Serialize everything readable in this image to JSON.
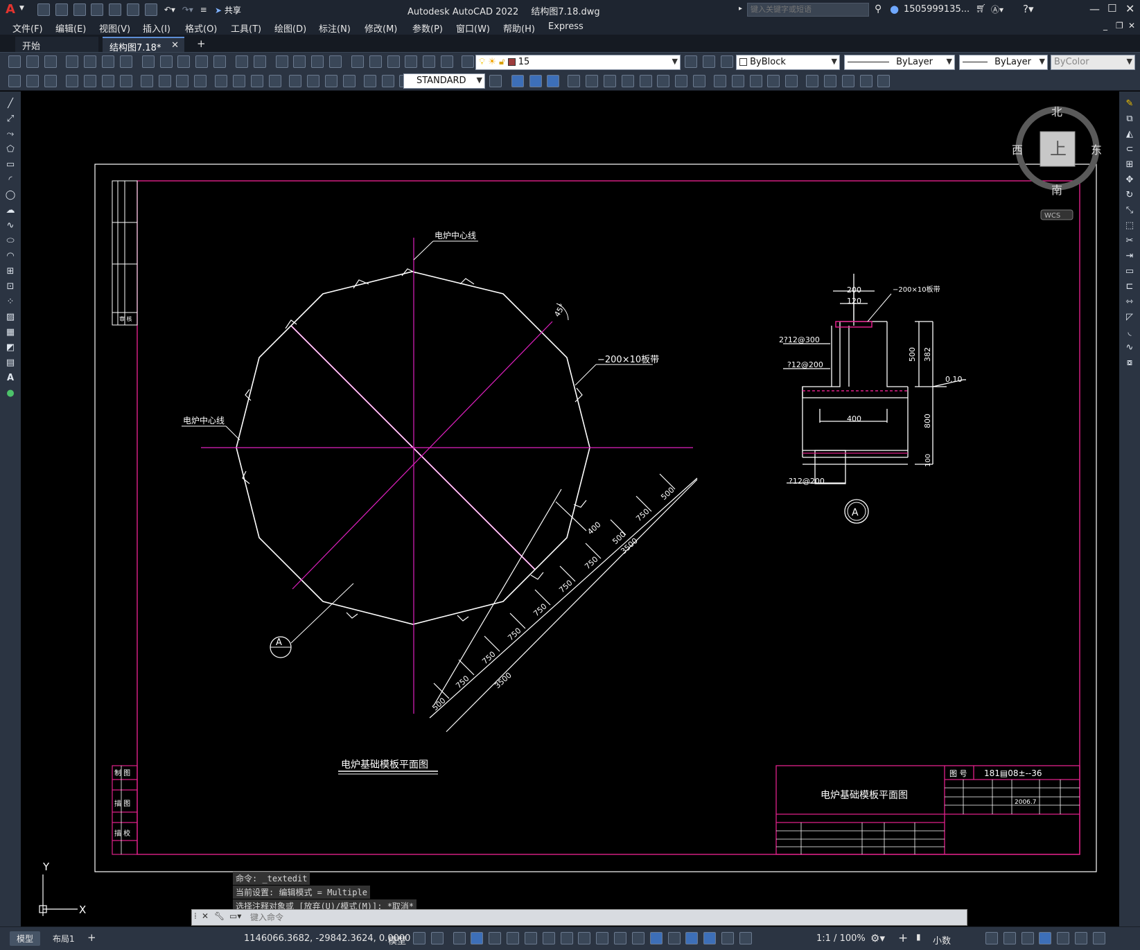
{
  "window": {
    "app_logo": "A",
    "title": "Autodesk AutoCAD 2022",
    "file": "结构图7.18.dwg",
    "share": "共享",
    "search_placeholder": "键入关键字或短语",
    "user": "1505999135...",
    "accent": "#c8102e"
  },
  "menu": [
    "文件(F)",
    "编辑(E)",
    "视图(V)",
    "插入(I)",
    "格式(O)",
    "工具(T)",
    "绘图(D)",
    "标注(N)",
    "修改(M)",
    "参数(P)",
    "窗口(W)",
    "帮助(H)",
    "Express"
  ],
  "tabs": [
    {
      "label": "开始",
      "active": false
    },
    {
      "label": "结构图7.18*",
      "active": true
    }
  ],
  "toolbar": {
    "layer": "15",
    "color": "ByBlock",
    "linetype": "ByLayer",
    "lineweight": "ByLayer",
    "plotstyle": "ByColor",
    "textstyle": "STANDARD"
  },
  "viewcube": {
    "north": "北",
    "south": "南",
    "east": "东",
    "west": "西",
    "top": "上",
    "wcs": "WCS"
  },
  "ucs": {
    "x": "X",
    "y": "Y"
  },
  "drawing": {
    "centerline_label": "电炉中心线",
    "angle_label": "45°",
    "band_label": "−200×10板带",
    "dims_outer": [
      "500",
      "750",
      "750",
      "750",
      "750",
      "750",
      "750",
      "500"
    ],
    "dim_total": "3500",
    "dim_400": "400",
    "section_marker": "A",
    "plan_title": "电炉基础模板平面图",
    "section": {
      "band": "−200×10板带",
      "w200": "200",
      "w120": "120",
      "rebar1": "2?12@300",
      "rebar2": "?12@200",
      "rebar3": "?12@200",
      "h500": "500",
      "h382": "382",
      "level": "0.10",
      "w400": "400",
      "h800": "800",
      "h100": "100",
      "marker": "A"
    },
    "title_block": {
      "drawing_no_label": "图 号",
      "drawing_no": "181▤08±--36",
      "title": "电炉基础模板平面图",
      "date": "2006.7"
    },
    "left_block": [
      "制 图",
      "描 图",
      "描 校"
    ],
    "left_top_label": "审 核"
  },
  "command": {
    "history": [
      "命令: _textedit",
      "当前设置: 编辑模式 = Multiple",
      "选择注释对象或 [放弃(U)/模式(M)]: *取消*"
    ],
    "placeholder": "键入命令"
  },
  "status": {
    "layout_tabs": [
      "模型",
      "布局1"
    ],
    "coords": "1146066.3682, -29842.3624, 0.0000",
    "mode": "模型",
    "scale": "1:1 / 100%",
    "units": "小数"
  }
}
